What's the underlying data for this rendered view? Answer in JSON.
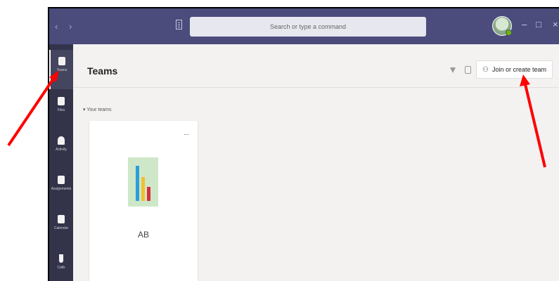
{
  "titlebar": {
    "nav_arrows": "‹ ›",
    "search_placeholder": "Search or type a command",
    "window_controls": [
      "–",
      "□",
      "×"
    ]
  },
  "rail": {
    "items": [
      {
        "label": "Teams",
        "icon": "teams-icon",
        "active": true
      },
      {
        "label": "Files",
        "icon": "files-icon",
        "active": false
      },
      {
        "label": "Activity",
        "icon": "bell-icon",
        "active": false
      },
      {
        "label": "Assignments",
        "icon": "assignments-icon",
        "active": false
      },
      {
        "label": "Calendar",
        "icon": "calendar-icon",
        "active": false
      },
      {
        "label": "Calls",
        "icon": "phone-icon",
        "active": false
      }
    ]
  },
  "header": {
    "title": "Teams",
    "join_button_label": "Join or create team"
  },
  "main": {
    "section_label": "▾ Your teams",
    "teams": [
      {
        "name": "AB",
        "more": "···"
      }
    ]
  },
  "colors": {
    "titlebar": "#4b4b7c",
    "rail": "#33344a",
    "annotation_arrow": "#ff0000"
  }
}
